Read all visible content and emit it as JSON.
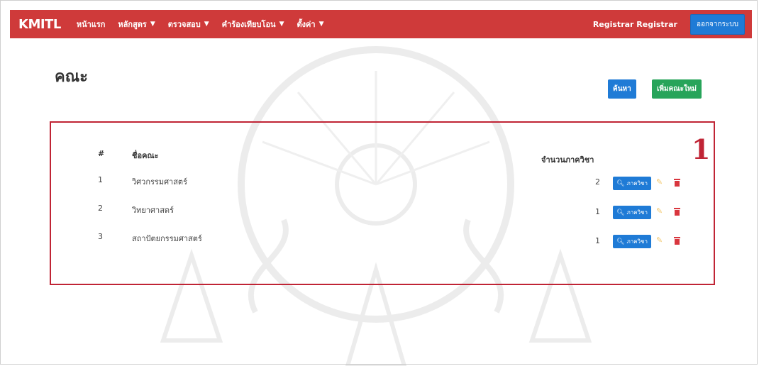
{
  "navbar": {
    "brand": "KMITL",
    "items": [
      {
        "label": "หน้าแรก",
        "dropdown": false
      },
      {
        "label": "หลักสูตร",
        "dropdown": true
      },
      {
        "label": "ตรวจสอบ",
        "dropdown": true
      },
      {
        "label": "คำร้องเทียบโอน",
        "dropdown": true
      },
      {
        "label": "ตั้งค่า",
        "dropdown": true
      }
    ],
    "user": "Registrar Registrar",
    "logout_label": "ออกจากระบบ"
  },
  "page": {
    "title": "คณะ",
    "search_label": "ค้นหา",
    "add_label": "เพิ่มคณะใหม่"
  },
  "annotation": {
    "number": "1",
    "color": "#c02435"
  },
  "table": {
    "headers": {
      "num": "#",
      "name": "ชื่อคณะ",
      "count": "จำนวนภาควิชา"
    },
    "rows": [
      {
        "num": "1",
        "name": "วิศวกรรมศาสตร์",
        "count": "2",
        "action": "ภาควิชา"
      },
      {
        "num": "2",
        "name": "วิทยาศาสตร์",
        "count": "1",
        "action": "ภาควิชา"
      },
      {
        "num": "3",
        "name": "สถาปัตยกรรมศาสตร์",
        "count": "1",
        "action": "ภาควิชา"
      }
    ]
  },
  "colors": {
    "navbar": "#cf3a3a",
    "primary": "#1f7bd6",
    "success": "#27a45a",
    "danger": "#d9363e"
  },
  "icons": {
    "search": "search-icon",
    "edit": "pencil-icon",
    "delete": "trash-icon"
  }
}
